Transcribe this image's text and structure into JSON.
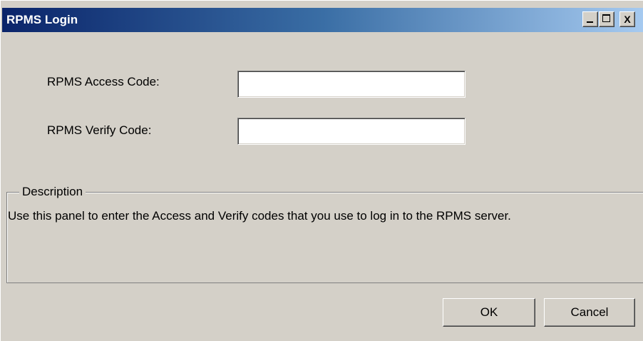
{
  "window": {
    "title": "RPMS Login",
    "titlebar_colors": [
      "#0a246a",
      "#a6caf0"
    ],
    "face_color": "#d4d0c8",
    "controls": [
      "minimize-icon",
      "maximize-icon",
      "close-icon"
    ],
    "close_glyph": "X"
  },
  "form": {
    "access_label": "RPMS Access Code:",
    "access_value": "",
    "verify_label": "RPMS Verify Code:",
    "verify_value": ""
  },
  "description": {
    "legend": "Description",
    "text": "Use this panel to enter the Access and Verify codes that you use to log in to the RPMS server."
  },
  "buttons": {
    "ok": "OK",
    "cancel": "Cancel"
  }
}
